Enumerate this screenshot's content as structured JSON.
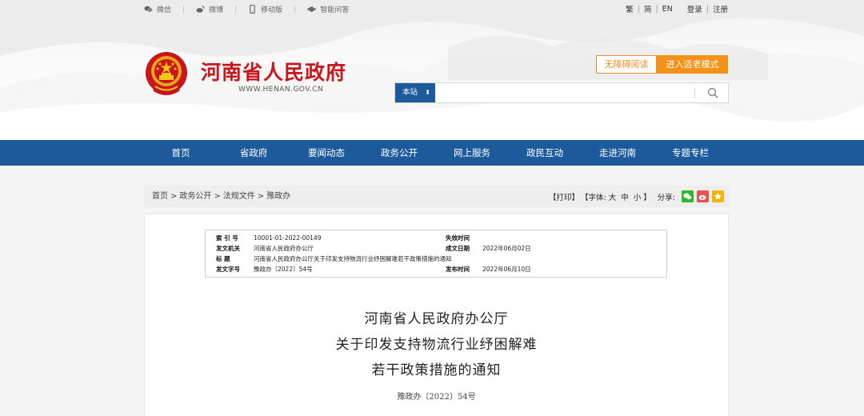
{
  "topbar": {
    "wechat": "微信",
    "weibo": "微博",
    "mobile": "移动版",
    "qa": "智能问答",
    "lang": {
      "trad": "繁",
      "simp": "简",
      "en": "EN"
    },
    "login": "登录",
    "register": "注册"
  },
  "header": {
    "site_title": "河南省人民政府",
    "site_url": "WWW.HENAN.GOV.CN",
    "accessible_label": "无障碍阅读",
    "elder_label": "进入适老模式"
  },
  "search": {
    "scope": "本站",
    "placeholder": ""
  },
  "nav": {
    "items": [
      "首页",
      "省政府",
      "要闻动态",
      "政务公开",
      "网上服务",
      "政民互动",
      "走进河南",
      "专题专栏"
    ]
  },
  "breadcrumb": {
    "items": [
      "首页",
      "政务公开",
      "法规文件",
      "豫政办"
    ],
    "separator": ">"
  },
  "tools": {
    "print": "【打印】",
    "font_prefix": "【字体:",
    "font_large": "大",
    "font_medium": "中",
    "font_small": "小",
    "font_suffix": "】",
    "share_label": "分享:"
  },
  "colors": {
    "nav_blue": "#1c5a9c",
    "brand_red": "#c8161d",
    "accent_orange": "#f39219"
  },
  "meta": {
    "index_label": "索 引 号",
    "index_value": "10001-01-2022-00149",
    "issuer_label": "发文机关",
    "issuer_value": "河南省人民政府办公厅",
    "title_label": "标 题",
    "title_value": "河南省人民政府办公厅关于印发支持物流行业纾困解难若干政策措施的通知",
    "docno_label": "发文字号",
    "docno_value": "豫政办〔2022〕54号",
    "expire_label": "失效时间",
    "expire_value": "",
    "created_label": "成文日期",
    "created_value": "2022年06月02日",
    "published_label": "发布时间",
    "published_value": "2022年06月10日"
  },
  "document": {
    "title_line1": "河南省人民政府办公厅",
    "title_line2": "关于印发支持物流行业纾困解难",
    "title_line3": "若干政策措施的通知",
    "doc_number": "豫政办〔2022〕54号"
  }
}
